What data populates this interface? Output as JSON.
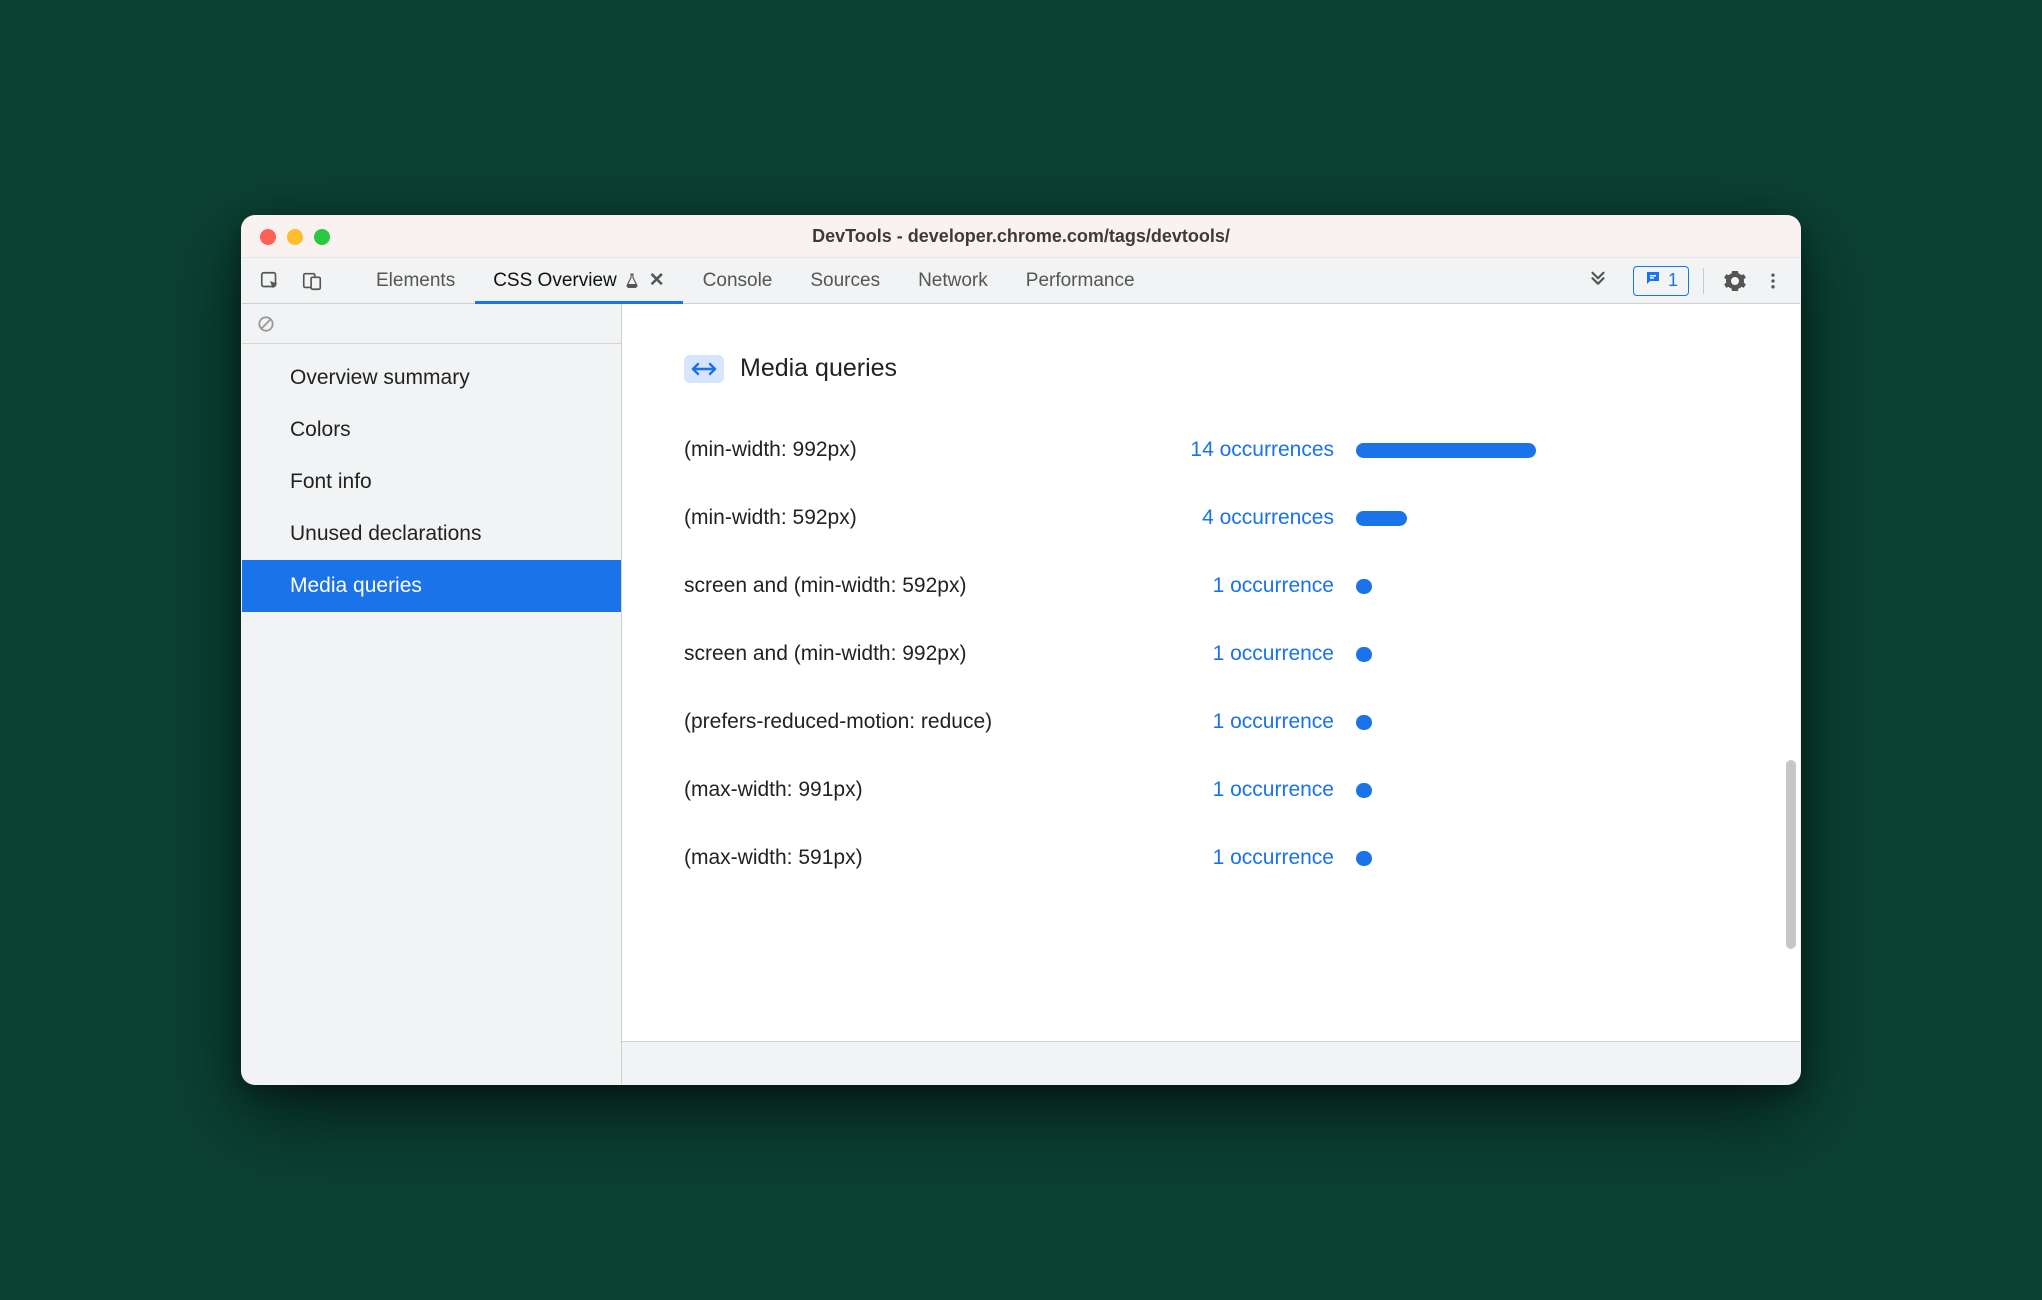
{
  "window": {
    "title": "DevTools - developer.chrome.com/tags/devtools/"
  },
  "toolbar": {
    "tabs": [
      {
        "label": "Elements",
        "active": false
      },
      {
        "label": "CSS Overview",
        "active": true,
        "experimental": true,
        "closable": true
      },
      {
        "label": "Console",
        "active": false
      },
      {
        "label": "Sources",
        "active": false
      },
      {
        "label": "Network",
        "active": false
      },
      {
        "label": "Performance",
        "active": false
      }
    ],
    "issues_count": "1"
  },
  "sidebar": {
    "items": [
      {
        "label": "Overview summary",
        "selected": false
      },
      {
        "label": "Colors",
        "selected": false
      },
      {
        "label": "Font info",
        "selected": false
      },
      {
        "label": "Unused declarations",
        "selected": false
      },
      {
        "label": "Media queries",
        "selected": true
      }
    ]
  },
  "main": {
    "section_title": "Media queries",
    "rows": [
      {
        "expr": "(min-width: 992px)",
        "count": 14,
        "text": "14 occurrences"
      },
      {
        "expr": "(min-width: 592px)",
        "count": 4,
        "text": "4 occurrences"
      },
      {
        "expr": "screen and (min-width: 592px)",
        "count": 1,
        "text": "1 occurrence"
      },
      {
        "expr": "screen and (min-width: 992px)",
        "count": 1,
        "text": "1 occurrence"
      },
      {
        "expr": "(prefers-reduced-motion: reduce)",
        "count": 1,
        "text": "1 occurrence"
      },
      {
        "expr": "(max-width: 991px)",
        "count": 1,
        "text": "1 occurrence"
      },
      {
        "expr": "(max-width: 591px)",
        "count": 1,
        "text": "1 occurrence"
      }
    ]
  },
  "chart_data": {
    "type": "bar",
    "title": "Media queries",
    "categories": [
      "(min-width: 992px)",
      "(min-width: 592px)",
      "screen and (min-width: 592px)",
      "screen and (min-width: 992px)",
      "(prefers-reduced-motion: reduce)",
      "(max-width: 991px)",
      "(max-width: 591px)"
    ],
    "values": [
      14,
      4,
      1,
      1,
      1,
      1,
      1
    ],
    "xlabel": "",
    "ylabel": "occurrences",
    "ylim": [
      0,
      14
    ]
  },
  "colors": {
    "accent": "#1a73e8"
  }
}
